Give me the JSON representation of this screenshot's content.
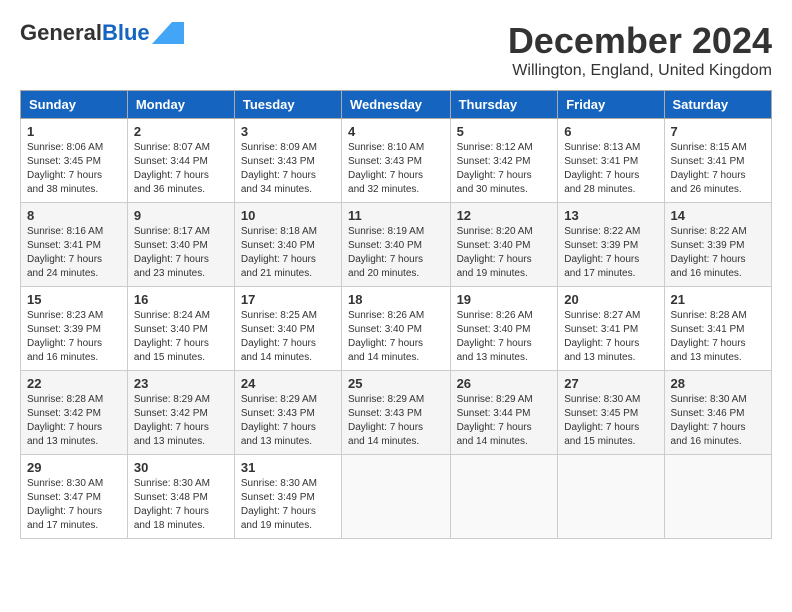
{
  "header": {
    "logo_general": "General",
    "logo_blue": "Blue",
    "title": "December 2024",
    "location": "Willington, England, United Kingdom"
  },
  "calendar": {
    "days_of_week": [
      "Sunday",
      "Monday",
      "Tuesday",
      "Wednesday",
      "Thursday",
      "Friday",
      "Saturday"
    ],
    "weeks": [
      [
        {
          "day": "1",
          "info": "Sunrise: 8:06 AM\nSunset: 3:45 PM\nDaylight: 7 hours\nand 38 minutes."
        },
        {
          "day": "2",
          "info": "Sunrise: 8:07 AM\nSunset: 3:44 PM\nDaylight: 7 hours\nand 36 minutes."
        },
        {
          "day": "3",
          "info": "Sunrise: 8:09 AM\nSunset: 3:43 PM\nDaylight: 7 hours\nand 34 minutes."
        },
        {
          "day": "4",
          "info": "Sunrise: 8:10 AM\nSunset: 3:43 PM\nDaylight: 7 hours\nand 32 minutes."
        },
        {
          "day": "5",
          "info": "Sunrise: 8:12 AM\nSunset: 3:42 PM\nDaylight: 7 hours\nand 30 minutes."
        },
        {
          "day": "6",
          "info": "Sunrise: 8:13 AM\nSunset: 3:41 PM\nDaylight: 7 hours\nand 28 minutes."
        },
        {
          "day": "7",
          "info": "Sunrise: 8:15 AM\nSunset: 3:41 PM\nDaylight: 7 hours\nand 26 minutes."
        }
      ],
      [
        {
          "day": "8",
          "info": "Sunrise: 8:16 AM\nSunset: 3:41 PM\nDaylight: 7 hours\nand 24 minutes."
        },
        {
          "day": "9",
          "info": "Sunrise: 8:17 AM\nSunset: 3:40 PM\nDaylight: 7 hours\nand 23 minutes."
        },
        {
          "day": "10",
          "info": "Sunrise: 8:18 AM\nSunset: 3:40 PM\nDaylight: 7 hours\nand 21 minutes."
        },
        {
          "day": "11",
          "info": "Sunrise: 8:19 AM\nSunset: 3:40 PM\nDaylight: 7 hours\nand 20 minutes."
        },
        {
          "day": "12",
          "info": "Sunrise: 8:20 AM\nSunset: 3:40 PM\nDaylight: 7 hours\nand 19 minutes."
        },
        {
          "day": "13",
          "info": "Sunrise: 8:22 AM\nSunset: 3:39 PM\nDaylight: 7 hours\nand 17 minutes."
        },
        {
          "day": "14",
          "info": "Sunrise: 8:22 AM\nSunset: 3:39 PM\nDaylight: 7 hours\nand 16 minutes."
        }
      ],
      [
        {
          "day": "15",
          "info": "Sunrise: 8:23 AM\nSunset: 3:39 PM\nDaylight: 7 hours\nand 16 minutes."
        },
        {
          "day": "16",
          "info": "Sunrise: 8:24 AM\nSunset: 3:40 PM\nDaylight: 7 hours\nand 15 minutes."
        },
        {
          "day": "17",
          "info": "Sunrise: 8:25 AM\nSunset: 3:40 PM\nDaylight: 7 hours\nand 14 minutes."
        },
        {
          "day": "18",
          "info": "Sunrise: 8:26 AM\nSunset: 3:40 PM\nDaylight: 7 hours\nand 14 minutes."
        },
        {
          "day": "19",
          "info": "Sunrise: 8:26 AM\nSunset: 3:40 PM\nDaylight: 7 hours\nand 13 minutes."
        },
        {
          "day": "20",
          "info": "Sunrise: 8:27 AM\nSunset: 3:41 PM\nDaylight: 7 hours\nand 13 minutes."
        },
        {
          "day": "21",
          "info": "Sunrise: 8:28 AM\nSunset: 3:41 PM\nDaylight: 7 hours\nand 13 minutes."
        }
      ],
      [
        {
          "day": "22",
          "info": "Sunrise: 8:28 AM\nSunset: 3:42 PM\nDaylight: 7 hours\nand 13 minutes."
        },
        {
          "day": "23",
          "info": "Sunrise: 8:29 AM\nSunset: 3:42 PM\nDaylight: 7 hours\nand 13 minutes."
        },
        {
          "day": "24",
          "info": "Sunrise: 8:29 AM\nSunset: 3:43 PM\nDaylight: 7 hours\nand 13 minutes."
        },
        {
          "day": "25",
          "info": "Sunrise: 8:29 AM\nSunset: 3:43 PM\nDaylight: 7 hours\nand 14 minutes."
        },
        {
          "day": "26",
          "info": "Sunrise: 8:29 AM\nSunset: 3:44 PM\nDaylight: 7 hours\nand 14 minutes."
        },
        {
          "day": "27",
          "info": "Sunrise: 8:30 AM\nSunset: 3:45 PM\nDaylight: 7 hours\nand 15 minutes."
        },
        {
          "day": "28",
          "info": "Sunrise: 8:30 AM\nSunset: 3:46 PM\nDaylight: 7 hours\nand 16 minutes."
        }
      ],
      [
        {
          "day": "29",
          "info": "Sunrise: 8:30 AM\nSunset: 3:47 PM\nDaylight: 7 hours\nand 17 minutes."
        },
        {
          "day": "30",
          "info": "Sunrise: 8:30 AM\nSunset: 3:48 PM\nDaylight: 7 hours\nand 18 minutes."
        },
        {
          "day": "31",
          "info": "Sunrise: 8:30 AM\nSunset: 3:49 PM\nDaylight: 7 hours\nand 19 minutes."
        },
        {
          "day": "",
          "info": ""
        },
        {
          "day": "",
          "info": ""
        },
        {
          "day": "",
          "info": ""
        },
        {
          "day": "",
          "info": ""
        }
      ]
    ]
  }
}
